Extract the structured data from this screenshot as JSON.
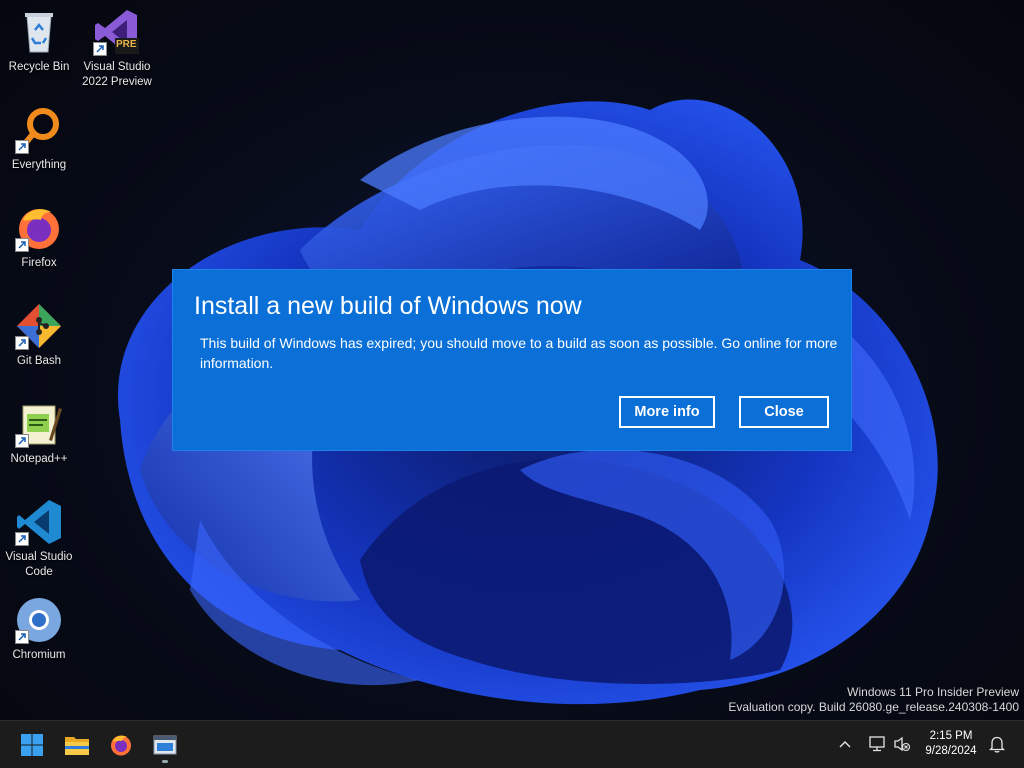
{
  "desktop": {
    "icons": [
      {
        "label": "Recycle Bin",
        "icon": "recycle-bin-icon"
      },
      {
        "label": "Visual Studio 2022 Preview",
        "icon": "visual-studio-icon",
        "badge": "PRE"
      },
      {
        "label": "Everything",
        "icon": "everything-search-icon"
      },
      {
        "label": "Firefox",
        "icon": "firefox-icon"
      },
      {
        "label": "Git Bash",
        "icon": "git-bash-icon"
      },
      {
        "label": "Notepad++",
        "icon": "notepad-plus-plus-icon"
      },
      {
        "label": "Visual Studio Code",
        "icon": "vscode-icon"
      },
      {
        "label": "Chromium",
        "icon": "chromium-icon"
      }
    ]
  },
  "dialog": {
    "title": "Install a new build of Windows now",
    "message": "This build of Windows has expired; you should move to a build as soon as possible. Go online for more information.",
    "more_info_label": "More info",
    "close_label": "Close",
    "bg_color": "#0a6fd6"
  },
  "watermark": {
    "line1": "Windows 11 Pro Insider Preview",
    "line2": "Evaluation copy. Build 26080.ge_release.240308-1400"
  },
  "taskbar": {
    "pinned": [
      "start-icon",
      "file-explorer-icon",
      "firefox-icon",
      "app-window-icon"
    ],
    "tray": [
      "chevron-up-icon",
      "network-icon",
      "volume-muted-icon",
      "notification-bell-icon"
    ],
    "time": "2:15 PM",
    "date": "9/28/2024"
  }
}
